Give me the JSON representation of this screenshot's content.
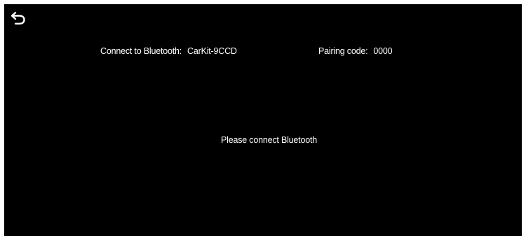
{
  "colors": {
    "screen_background": "#000000",
    "text": "#ffffff",
    "border": "#ffffff"
  },
  "header": {
    "back_icon": "back-arrow-icon"
  },
  "bluetooth": {
    "label": "Connect to Bluetooth:",
    "device_name": "CarKit-9CCD"
  },
  "pairing": {
    "label": "Pairing code:",
    "code": "0000"
  },
  "status": {
    "message": "Please connect Bluetooth"
  }
}
